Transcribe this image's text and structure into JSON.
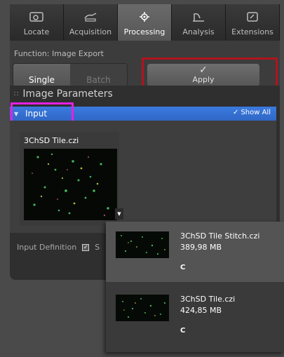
{
  "tabs": [
    {
      "label": "Locate",
      "icon": "locate-icon"
    },
    {
      "label": "Acquisition",
      "icon": "acquisition-icon"
    },
    {
      "label": "Processing",
      "icon": "processing-icon",
      "active": true
    },
    {
      "label": "Analysis",
      "icon": "analysis-icon"
    },
    {
      "label": "Extensions",
      "icon": "extensions-icon"
    }
  ],
  "function": {
    "label": "Function:  Image Export"
  },
  "mode": {
    "single": "Single",
    "batch": "Batch",
    "selected": "Single"
  },
  "apply_button": {
    "icon": "checkmark-icon",
    "label": "Apply"
  },
  "image_parameters": {
    "title": "Image Parameters"
  },
  "input_section": {
    "label": "Input",
    "show_all_label": "Show All",
    "show_all_checked": true
  },
  "input_image": {
    "name": "3ChSD Tile.czi"
  },
  "input_definition": {
    "label": "Input Definition",
    "checkbox_label": "S",
    "checked": true
  },
  "dropdown": {
    "items": [
      {
        "name": "3ChSD Tile Stitch.czi",
        "size": "389,98 MB",
        "tag": "C",
        "selected": true
      },
      {
        "name": "3ChSD Tile.czi",
        "size": "424,85 MB",
        "tag": "C",
        "selected": false
      }
    ]
  },
  "colors": {
    "accent_blue": "#3b7be0",
    "highlight_red": "#b0141e",
    "highlight_magenta": "#e520e5",
    "panel_dark": "#2f2f2f"
  }
}
